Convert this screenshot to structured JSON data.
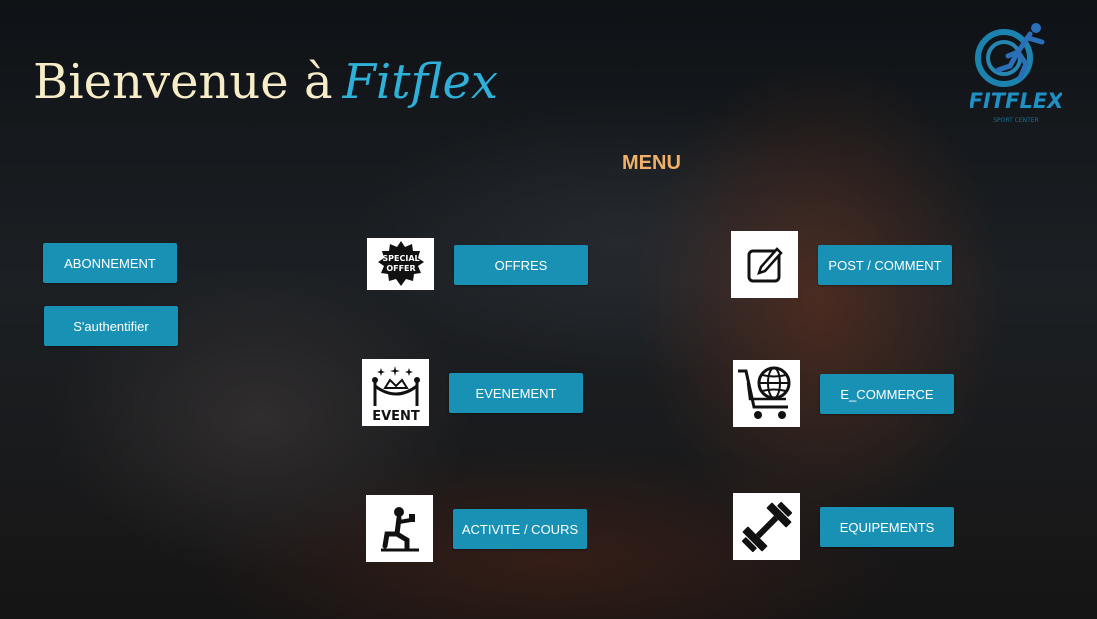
{
  "header": {
    "title_prefix": "Bienvenue à",
    "title_brand": "Fitflex",
    "logo_text": "FITFLEX",
    "logo_subtext": "SPORT CENTER"
  },
  "menu": {
    "title": "MENU",
    "buttons": {
      "abonnement": "ABONNEMENT",
      "authentifier": "S'authentifier",
      "offres": "OFFRES",
      "post_comment": "POST / COMMENT",
      "evenement": "EVENEMENT",
      "ecommerce": "E_COMMERCE",
      "activite": "ACTIVITE / COURS",
      "equipements": "EQUIPEMENTS"
    },
    "icons": {
      "special_offer_line1": "SPECIAL",
      "special_offer_line2": "OFFER",
      "event": "EVENT"
    }
  },
  "colors": {
    "accent": "#1991b4",
    "brand": "#2fb0d8",
    "menu_title": "#f0b068",
    "title": "#f6edc8"
  }
}
